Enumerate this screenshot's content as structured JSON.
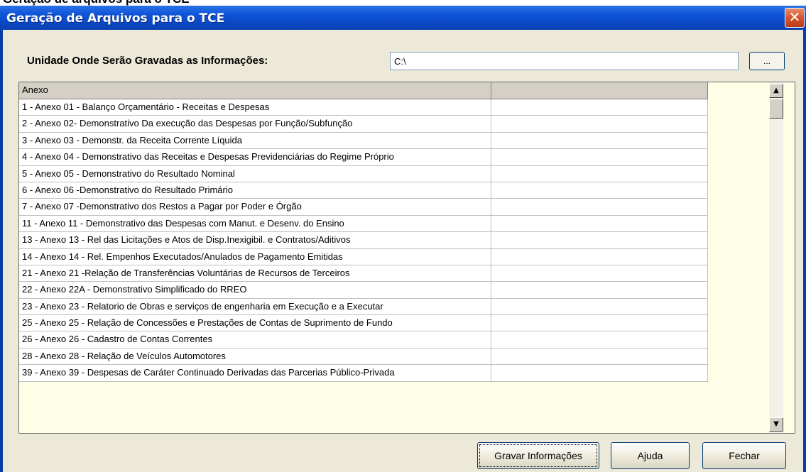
{
  "top_cut_text": "Geração de arquivos para o TCE",
  "window": {
    "title": "Geração de Arquivos para o TCE",
    "close_glyph": "✕"
  },
  "unit": {
    "label": "Unidade Onde Serão Gravadas as Informações:",
    "path_value": "C:\\",
    "browse_label": "..."
  },
  "grid": {
    "columns": [
      "Anexo",
      ""
    ],
    "rows": [
      "1 - Anexo 01 - Balanço Orçamentário - Receitas e Despesas",
      "2 - Anexo 02- Demonstrativo Da execução das Despesas por Função/Subfunção",
      "3 - Anexo 03 - Demonstr. da Receita Corrente Líquida",
      "4 - Anexo 04 - Demonstrativo das Receitas e Despesas Previdenciárias do Regime Próprio",
      "5 - Anexo 05 - Demonstrativo do Resultado Nominal",
      "6 - Anexo 06 -Demonstrativo do Resultado Primário",
      "7 - Anexo 07 -Demonstrativo dos Restos a Pagar por Poder e Órgão",
      "11 - Anexo 11 - Demonstrativo das Despesas com Manut. e Desenv. do Ensino",
      "13 - Anexo 13 - Rel das Licitações e Atos de Disp.Inexigibil. e Contratos/Aditivos",
      "14 - Anexo 14 - Rel. Empenhos Executados/Anulados de Pagamento Emitidas",
      "21 - Anexo 21 -Relação de Transferências Voluntárias de Recursos de Terceiros",
      "22 - Anexo 22A - Demonstrativo Simplificado do RREO",
      "23 - Anexo 23 - Relatorio de Obras e serviços de engenharia em Execução e a Executar",
      "25 - Anexo 25 - Relação de Concessões e Prestações de Contas de Suprimento de Fundo",
      "26 - Anexo 26 - Cadastro de Contas Correntes",
      "28 - Anexo 28 - Relação de Veículos Automotores",
      "39 - Anexo 39 - Despesas de Caráter Continuado Derivadas das Parcerias Público-Privada"
    ],
    "scroll_up_glyph": "▲",
    "scroll_down_glyph": "▼"
  },
  "buttons": {
    "gravar": "Gravar Informações",
    "ajuda": "Ajuda",
    "fechar": "Fechar"
  },
  "colors": {
    "title_bar": "#0b48c6",
    "client_bg": "#ece9d8",
    "grid_fill": "#fffee6",
    "close_button": "#d2502a"
  },
  "icons": [
    "close-icon",
    "scroll-up-icon",
    "scroll-down-icon"
  ]
}
